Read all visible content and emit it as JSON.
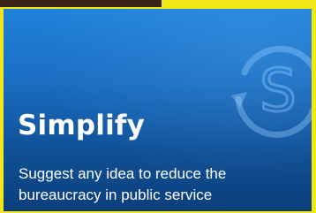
{
  "card": {
    "title": "Simplify",
    "description_line1": "Suggest any idea to reduce the",
    "description_line2": "bureaucracy in public service"
  },
  "logo": {
    "letter": "S",
    "icon": "circular-arrows-s-icon"
  },
  "colors": {
    "page_background": "#f2e71a",
    "top_strip": "#3b2417",
    "card_top": "#1f83d9",
    "card_bottom": "#0b3f7a",
    "text": "#ffffff"
  }
}
